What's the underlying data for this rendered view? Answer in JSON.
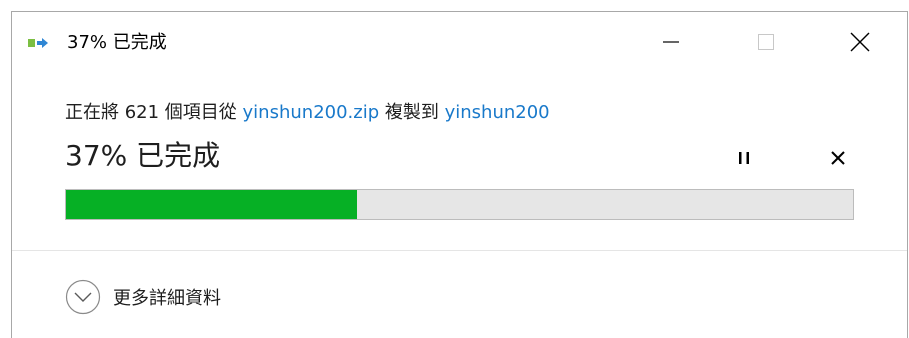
{
  "window": {
    "title": "37% 已完成",
    "minimize_icon": "minimize-icon",
    "maximize_icon": "maximize-icon",
    "close_icon": "close-icon"
  },
  "status": {
    "prefix": "正在將 621 個項目從 ",
    "source": "yinshun200.zip",
    "middle": " 複製到 ",
    "destination": "yinshun200"
  },
  "progress": {
    "percent_text": "37% 已完成",
    "percent": 37,
    "fill_color": "#06b025"
  },
  "controls": {
    "pause_icon": "pause-icon",
    "cancel_icon": "cancel-icon"
  },
  "details": {
    "label": "更多詳細資料",
    "icon": "chevron-down-circle-icon"
  },
  "colors": {
    "link": "#1979ca",
    "progress_track": "#e6e6e6",
    "progress_fill": "#06b025"
  }
}
